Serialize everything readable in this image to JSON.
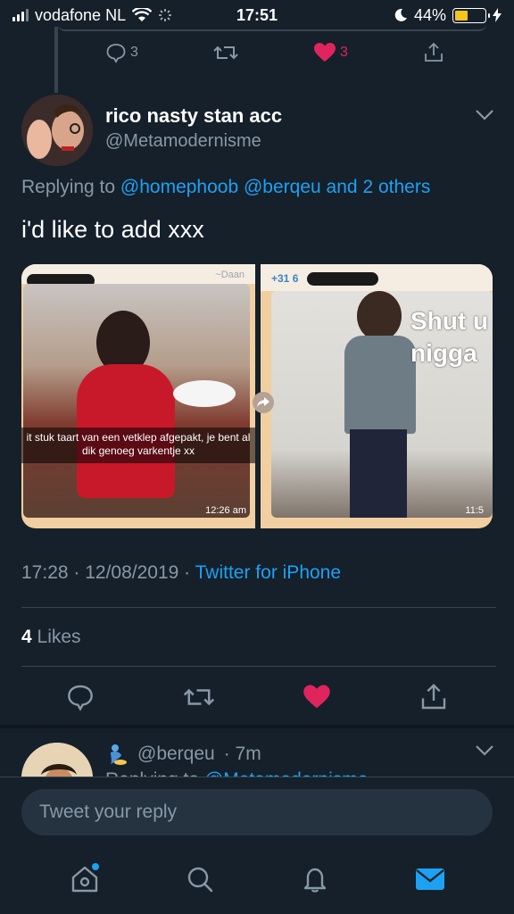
{
  "status_bar": {
    "carrier": "vodafone NL",
    "time": "17:51",
    "battery": "44%",
    "battery_level": 0.44
  },
  "previous_tweet": {
    "reply_count": "3",
    "like_count": "3"
  },
  "tweet": {
    "author_name": "rico nasty stan acc",
    "author_handle": "@Metamodernisme",
    "replying_prefix": "Replying to",
    "replying_users": "@homephoob @berqeu",
    "replying_and": "and",
    "replying_others": "2 others",
    "text": "i'd like to add xxx",
    "timestamp": "17:28 · 12/08/2019 ·",
    "source": "Twitter for iPhone",
    "likes_count": "4",
    "likes_label": "Likes"
  },
  "media": {
    "left": {
      "sender": "~Daan",
      "caption": "it stuk taart van een vetklep afgepakt, je bent al dik genoeg varkentje xx",
      "time": "12:26 am"
    },
    "right": {
      "phone_prefix": "+31 6",
      "overlay_text_line1": "Shut u",
      "overlay_text_line2": "nigga",
      "time": "11:5"
    }
  },
  "reply_preview": {
    "handle": "@berqeu",
    "age": "· 7m",
    "replying_prefix": "Replying to",
    "replying_user": "@Metamodernisme"
  },
  "composer": {
    "placeholder": "Tweet your reply"
  },
  "colors": {
    "background": "#15202b",
    "accent": "#1da1f2",
    "muted": "#8899a6",
    "like": "#e0245e"
  }
}
